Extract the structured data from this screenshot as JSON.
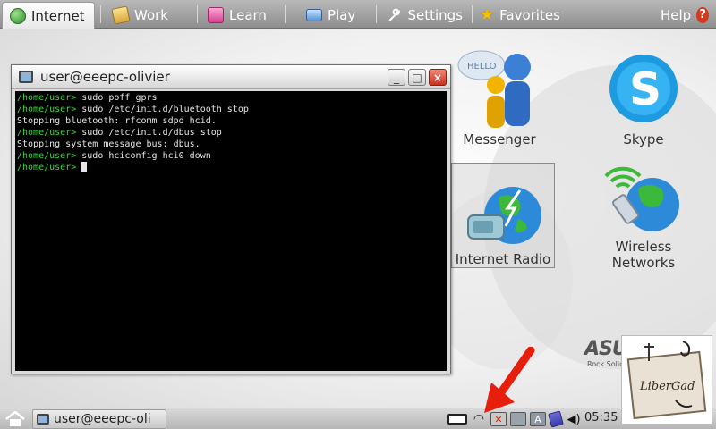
{
  "topbar": {
    "tabs": [
      {
        "label": "Internet",
        "icon": "internet-globe-icon",
        "active": true
      },
      {
        "label": "Work",
        "icon": "work-icon",
        "active": false
      },
      {
        "label": "Learn",
        "icon": "learn-icon",
        "active": false
      },
      {
        "label": "Play",
        "icon": "play-icon",
        "active": false
      },
      {
        "label": "Settings",
        "icon": "settings-wrench-icon",
        "active": false
      },
      {
        "label": "Favorites",
        "icon": "favorites-star-icon",
        "active": false
      }
    ],
    "help_label": "Help",
    "help_glyph": "?"
  },
  "desktop": {
    "apps": [
      {
        "label": "Messenger",
        "icon": "messenger-icon",
        "badge": "HELLO"
      },
      {
        "label": "Skype",
        "icon": "skype-icon",
        "badge": "S"
      },
      {
        "label": "Internet Radio",
        "icon": "internet-radio-icon",
        "selected": true
      },
      {
        "label_line1": "Wireless",
        "label_line2": "Networks",
        "icon": "wireless-networks-icon"
      }
    ],
    "brand_logo": "ASUS",
    "brand_tagline": "Rock Solid"
  },
  "terminal": {
    "title": "user@eeepc-olivier",
    "buttons": {
      "minimize": "_",
      "maximize": "□",
      "close": "×"
    },
    "lines": [
      {
        "prompt": "/home/user>",
        "text": " sudo poff gprs"
      },
      {
        "prompt": "/home/user>",
        "text": " sudo /etc/init.d/bluetooth stop"
      },
      {
        "prompt": "",
        "text": "Stopping bluetooth: rfcomm sdpd hcid."
      },
      {
        "prompt": "/home/user>",
        "text": " sudo /etc/init.d/dbus stop"
      },
      {
        "prompt": "",
        "text": "Stopping system message bus: dbus."
      },
      {
        "prompt": "/home/user>",
        "text": " sudo hciconfig hci0 down"
      },
      {
        "prompt": "/home/user>",
        "text": " "
      }
    ]
  },
  "taskbar": {
    "task_label": "user@eeepc-oli",
    "clock": "05:35",
    "tray_icons": [
      "battery-icon",
      "wifi-icon",
      "network-disabled-icon",
      "keyboard-icon",
      "input-method-icon",
      "storage-icon",
      "volume-icon"
    ],
    "input_letter": "A"
  },
  "colors": {
    "prompt": "#37d637",
    "terminal_bg": "#000000",
    "accent_red": "#e81e0d"
  },
  "watermark": {
    "text": "LiberGad"
  }
}
